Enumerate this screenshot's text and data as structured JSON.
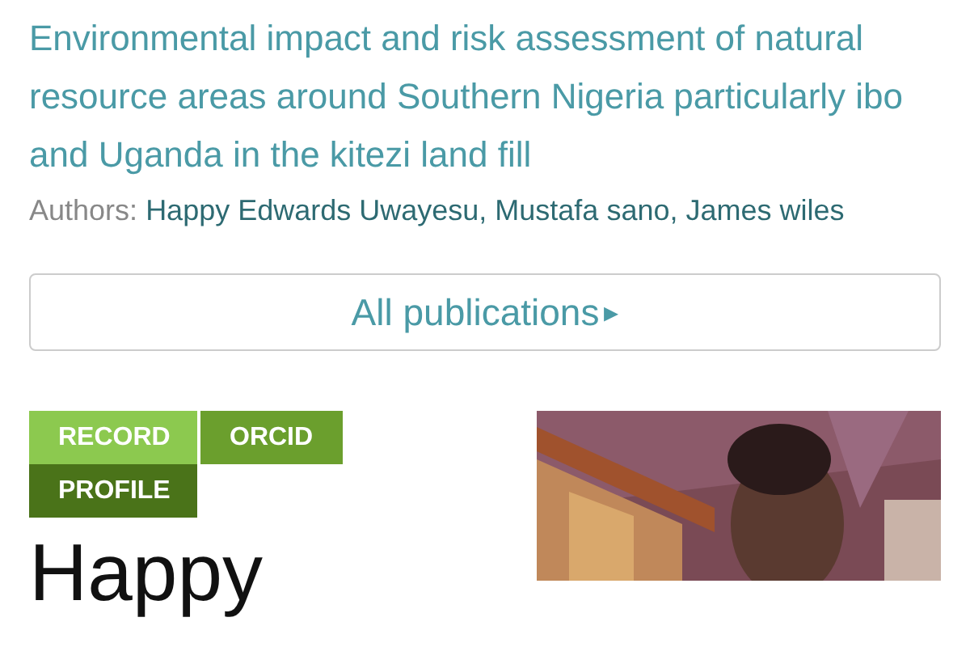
{
  "publication": {
    "title": "Environmental impact and risk assessment of natural resource areas around Southern Nigeria particularly ibo and Uganda in the kitezi land fill",
    "authors_label": "Authors:",
    "authors": "Happy Edwards Uwayesu, Mustafa sano, James wiles"
  },
  "all_publications_button": {
    "label": "All publications",
    "icon": "▸"
  },
  "profile": {
    "tags": [
      {
        "label": "RECORD",
        "color": "#8cc94f"
      },
      {
        "label": "ORCID",
        "color": "#6b9f2d"
      },
      {
        "label": "PROFILE",
        "color": "#4a7319"
      }
    ],
    "name": "Happy"
  }
}
